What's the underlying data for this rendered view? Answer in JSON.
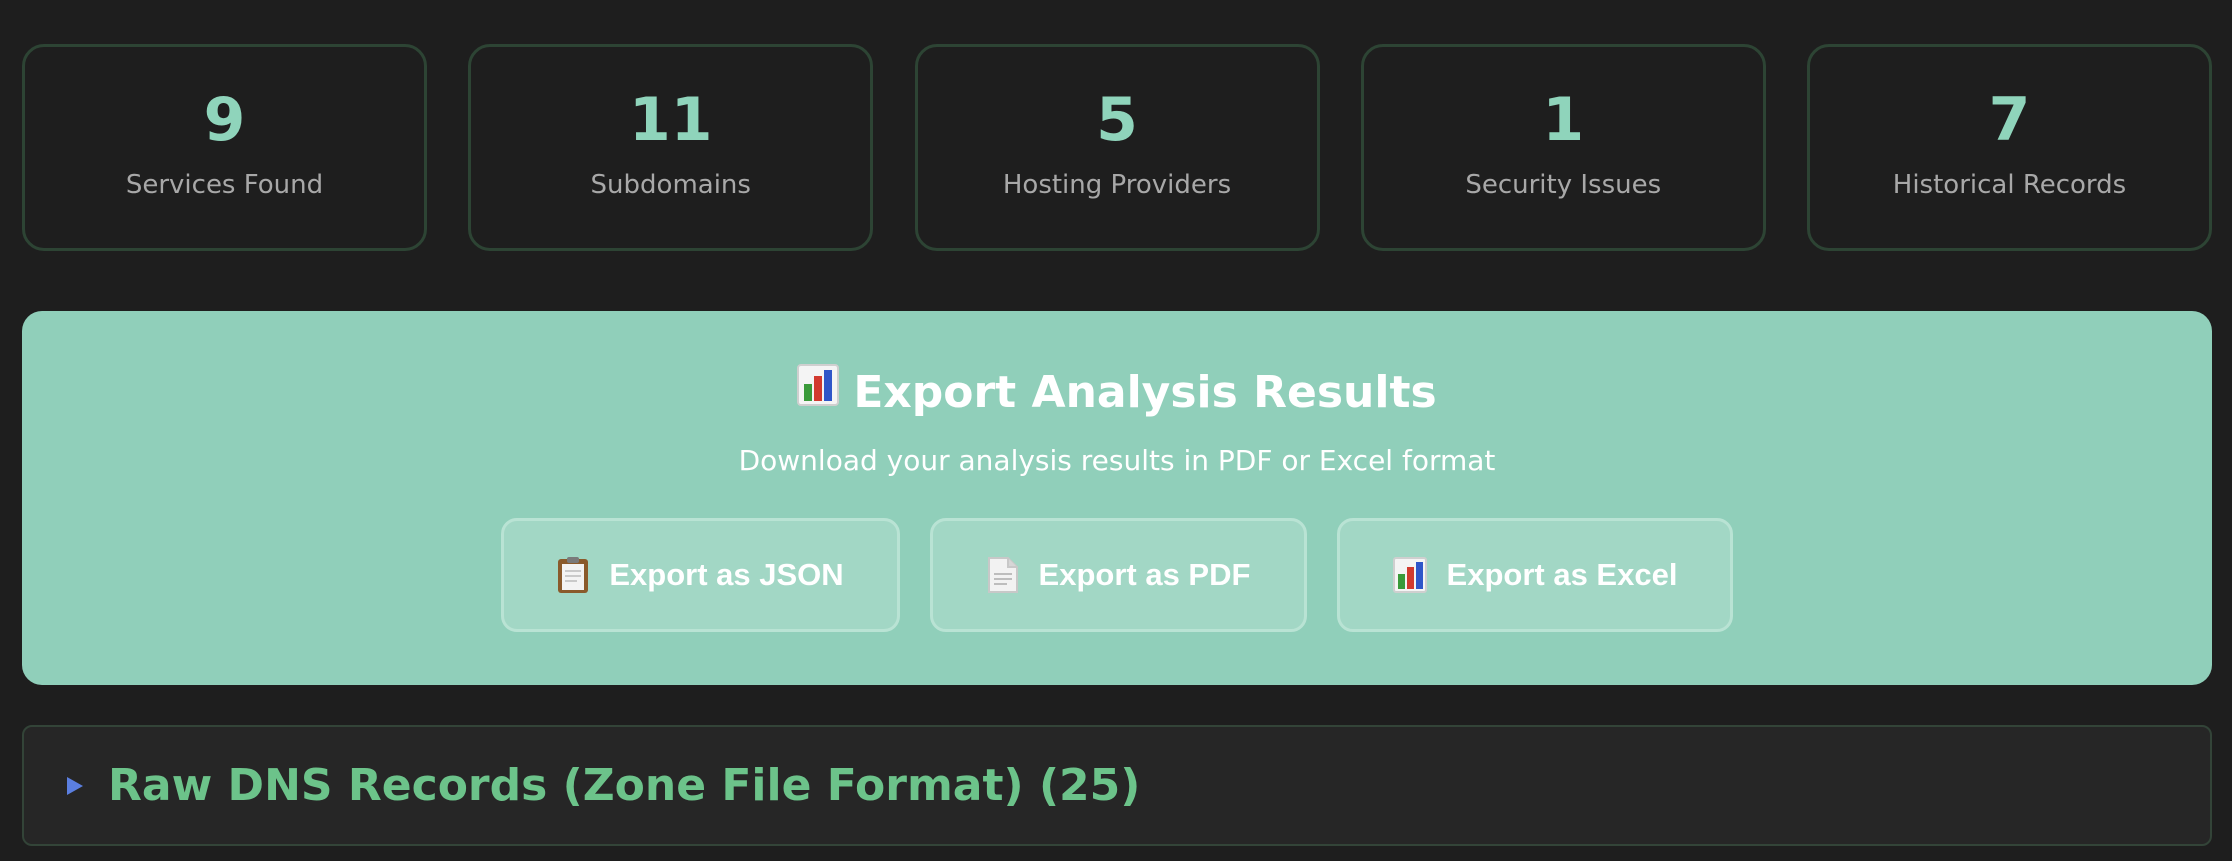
{
  "top_fragment": "",
  "stats": [
    {
      "value": "9",
      "label": "Services Found"
    },
    {
      "value": "11",
      "label": "Subdomains"
    },
    {
      "value": "5",
      "label": "Hosting Providers"
    },
    {
      "value": "1",
      "label": "Security Issues"
    },
    {
      "value": "7",
      "label": "Historical Records"
    }
  ],
  "export": {
    "title_icon": "bar-chart-icon",
    "title": "Export Analysis Results",
    "subtitle": "Download your analysis results in PDF or Excel format",
    "buttons": [
      {
        "icon": "clipboard-icon",
        "label": "Export as JSON"
      },
      {
        "icon": "document-icon",
        "label": "Export as PDF"
      },
      {
        "icon": "bar-chart-icon",
        "label": "Export as Excel"
      }
    ]
  },
  "dns_section": {
    "toggle_icon": "triangle-right-icon",
    "title": "Raw DNS Records (Zone File Format) (25)"
  },
  "colors": {
    "background": "#1e1e1e",
    "accent": "#8fd4bb",
    "panel": "#90cfba",
    "section_title": "#6cc38a",
    "toggle": "#5b7fe0"
  }
}
